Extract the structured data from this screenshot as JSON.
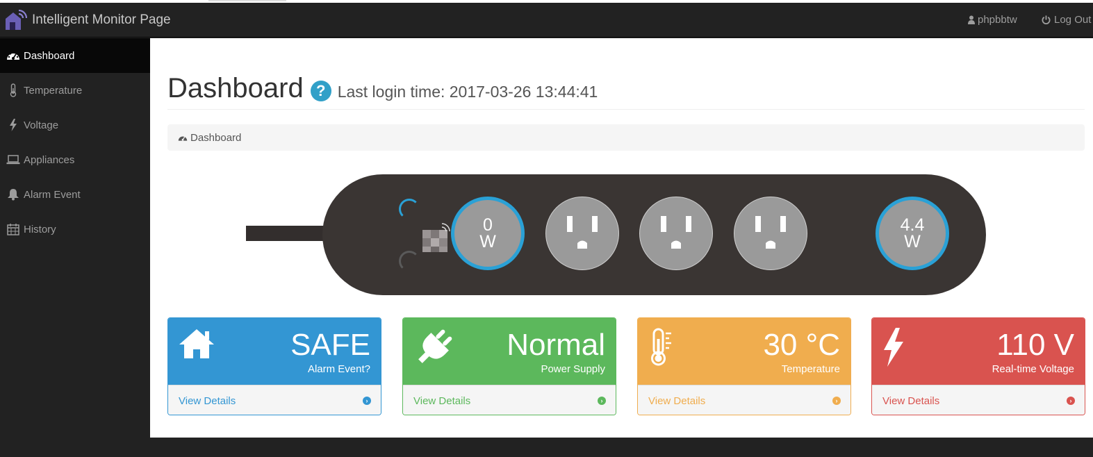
{
  "navbar": {
    "brand_title": "Intelligent Monitor Page",
    "user_name": "phpbbtw",
    "logout_label": "Log Out"
  },
  "sidebar": {
    "items": [
      {
        "label": "Dashboard",
        "icon": "dashboard-icon",
        "active": true
      },
      {
        "label": "Temperature",
        "icon": "thermometer-icon"
      },
      {
        "label": "Voltage",
        "icon": "bolt-icon"
      },
      {
        "label": "Appliances",
        "icon": "laptop-icon"
      },
      {
        "label": "Alarm Event",
        "icon": "bell-icon"
      },
      {
        "label": "History",
        "icon": "calendar-icon"
      }
    ]
  },
  "header": {
    "title": "Dashboard",
    "help_symbol": "?",
    "last_login": "Last login time: 2017-03-26 13:44:41"
  },
  "breadcrumb": {
    "label": "Dashboard"
  },
  "power_strip": {
    "outlet1": {
      "value": "0",
      "unit": "W"
    },
    "outlet5": {
      "value": "4.4",
      "unit": "W"
    }
  },
  "panels": [
    {
      "value": "SAFE",
      "label": "Alarm Event?",
      "link": "View Details",
      "color": "#3396d3"
    },
    {
      "value": "Normal",
      "label": "Power Supply",
      "link": "View Details",
      "color": "#5cb85c"
    },
    {
      "value": "30 °C",
      "label": "Temperature",
      "link": "View Details",
      "color": "#f0ad4e"
    },
    {
      "value": "110 V",
      "label": "Real-time Voltage",
      "link": "View Details",
      "color": "#d9534f"
    }
  ]
}
